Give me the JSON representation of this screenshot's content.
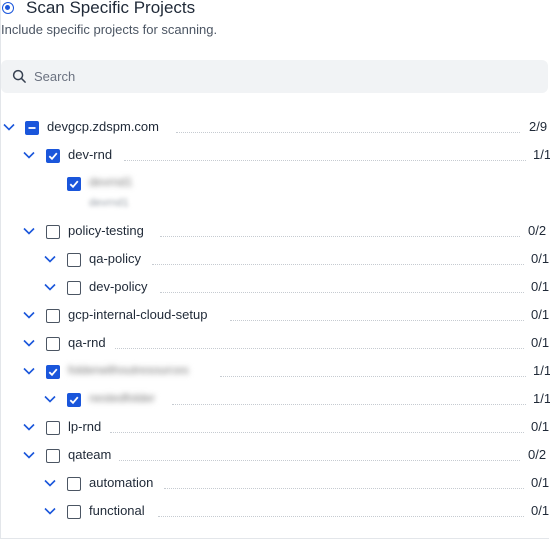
{
  "header": {
    "title": "Scan Specific Projects",
    "subtitle": "Include specific projects for scanning."
  },
  "search": {
    "placeholder": "Search"
  },
  "tree": {
    "root": {
      "label": "devgcp.zdspm.com",
      "count": "2/9",
      "state": "partial"
    },
    "items": [
      {
        "label": "dev-rnd",
        "count": "1/1",
        "state": "checked"
      },
      {
        "label": "devrnd1",
        "sublabel": "devrnd1",
        "count": "",
        "state": "checked"
      },
      {
        "label": "policy-testing",
        "count": "0/2",
        "state": "unchecked"
      },
      {
        "label": "qa-policy",
        "count": "0/1",
        "state": "unchecked"
      },
      {
        "label": "dev-policy",
        "count": "0/1",
        "state": "unchecked"
      },
      {
        "label": "gcp-internal-cloud-setup",
        "count": "0/1",
        "state": "unchecked"
      },
      {
        "label": "qa-rnd",
        "count": "0/1",
        "state": "unchecked"
      },
      {
        "label": "folderwithoutresources",
        "count": "1/1",
        "state": "checked"
      },
      {
        "label": "nestedfolder",
        "count": "1/1",
        "state": "checked"
      },
      {
        "label": "lp-rnd",
        "count": "0/1",
        "state": "unchecked"
      },
      {
        "label": "qateam",
        "count": "0/2",
        "state": "unchecked"
      },
      {
        "label": "automation",
        "count": "0/1",
        "state": "unchecked"
      },
      {
        "label": "functional",
        "count": "0/1",
        "state": "unchecked"
      }
    ]
  },
  "icons": {
    "search": "search-icon",
    "expand": "chevron-down-icon",
    "check": "check-icon",
    "partial": "minus-icon"
  },
  "colors": {
    "accent": "#1a56db",
    "search_bg": "#f1f3f5"
  }
}
